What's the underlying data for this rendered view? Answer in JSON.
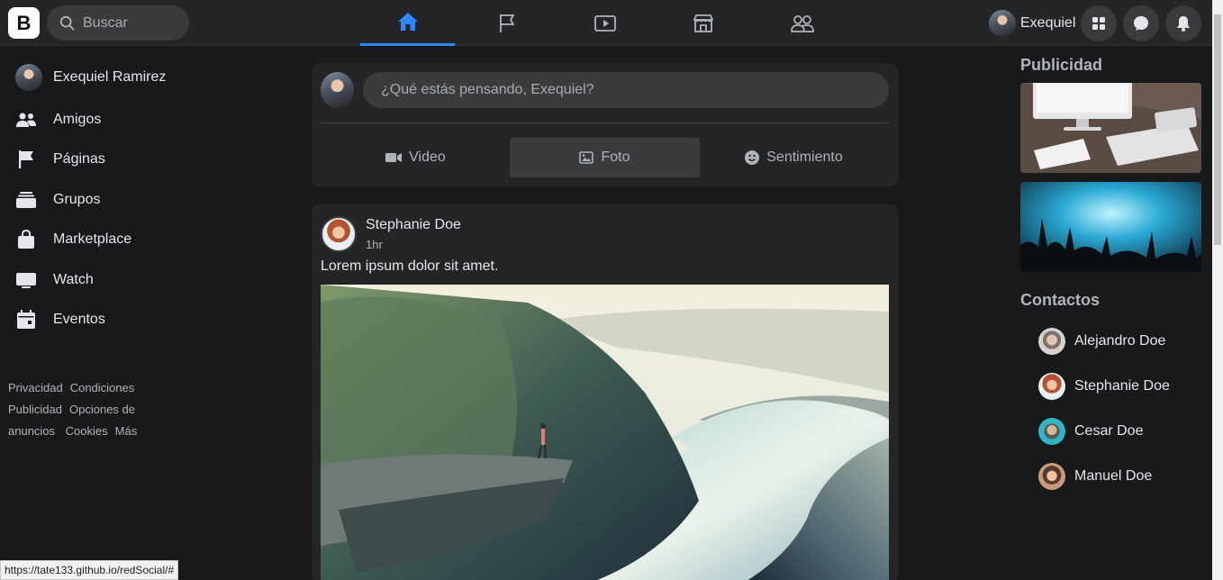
{
  "topbar": {
    "logo": "B",
    "search_placeholder": "Buscar",
    "nav": [
      "home-icon",
      "pages-flag-icon",
      "watch-icon",
      "marketplace-icon",
      "groups-icon"
    ],
    "active_index": 0,
    "user_name": "Exequiel",
    "accent": "#2d88ff"
  },
  "sidebar": {
    "profile_name": "Exequiel Ramirez",
    "items": [
      {
        "label": "Amigos",
        "icon": "friends-icon"
      },
      {
        "label": "Páginas",
        "icon": "flag-icon"
      },
      {
        "label": "Grupos",
        "icon": "groups-icon"
      },
      {
        "label": "Marketplace",
        "icon": "shopping-bag-icon"
      },
      {
        "label": "Watch",
        "icon": "monitor-icon"
      },
      {
        "label": "Eventos",
        "icon": "calendar-icon"
      }
    ],
    "footer": [
      "Privacidad",
      "Condiciones",
      "Publicidad",
      "Opciones de anuncios",
      "Cookies",
      "Más"
    ]
  },
  "composer": {
    "placeholder": "¿Qué estás pensando, Exequiel?",
    "buttons": [
      {
        "label": "Video",
        "icon": "video-camera-icon"
      },
      {
        "label": "Foto",
        "icon": "photo-icon"
      },
      {
        "label": "Sentimiento",
        "icon": "smiley-icon"
      }
    ]
  },
  "post": {
    "author": "Stephanie Doe",
    "time": "1hr",
    "text": "Lorem ipsum dolor sit amet."
  },
  "right": {
    "ads_title": "Publicidad",
    "contacts_title": "Contactos",
    "contacts": [
      "Alejandro Doe",
      "Stephanie Doe",
      "Cesar Doe",
      "Manuel Doe"
    ]
  },
  "status_url": "https://tate133.github.io/redSocial/#"
}
